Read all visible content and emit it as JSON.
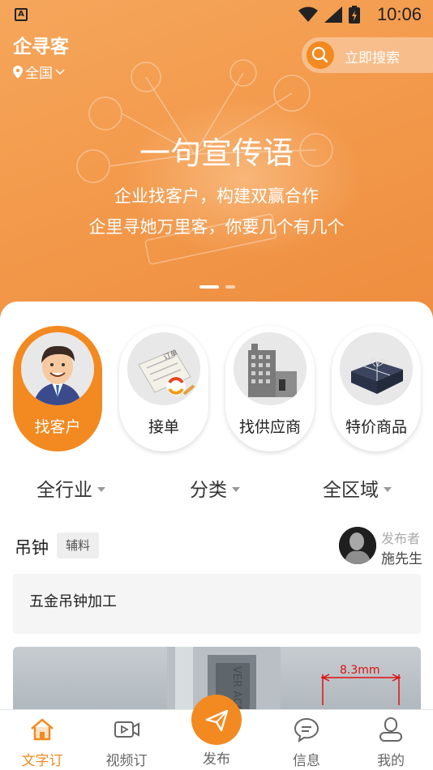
{
  "status_bar": {
    "time": "10:06"
  },
  "header": {
    "brand": "企寻客",
    "location": "全国",
    "search_label": "立即搜索"
  },
  "banner": {
    "slogan": "一句宣传语",
    "line1": "企业找客户，构建双赢合作",
    "line2": "企里寻她万里客，你要几个有几个",
    "slides": 2,
    "active_slide": 1
  },
  "categories": [
    {
      "label": "找客户",
      "icon": "customer-icon",
      "active": true
    },
    {
      "label": "接单",
      "icon": "order-icon",
      "active": false
    },
    {
      "label": "找供应商",
      "icon": "supplier-icon",
      "active": false
    },
    {
      "label": "特价商品",
      "icon": "gift-box-icon",
      "active": false
    }
  ],
  "filters": [
    {
      "label": "全行业"
    },
    {
      "label": "分类"
    },
    {
      "label": "全区域"
    }
  ],
  "post": {
    "title": "吊钟",
    "tag": "辅料",
    "publisher_label": "发布者",
    "publisher_name": "施先生",
    "description": "五金吊钟加工",
    "image_annotation": "8.3mm",
    "image_text": "VER ACE"
  },
  "tabbar": {
    "tabs": [
      {
        "label": "文字订",
        "icon": "home-icon",
        "active": true
      },
      {
        "label": "视频订",
        "icon": "video-icon",
        "active": false
      },
      {
        "label": "发布",
        "icon": "send-icon",
        "active": false
      },
      {
        "label": "信息",
        "icon": "message-icon",
        "active": false
      },
      {
        "label": "我的",
        "icon": "user-icon",
        "active": false
      }
    ]
  },
  "colors": {
    "accent": "#f28a21",
    "hero_orange": "#f39a4c",
    "text_primary": "#222222",
    "text_muted": "#999999"
  }
}
